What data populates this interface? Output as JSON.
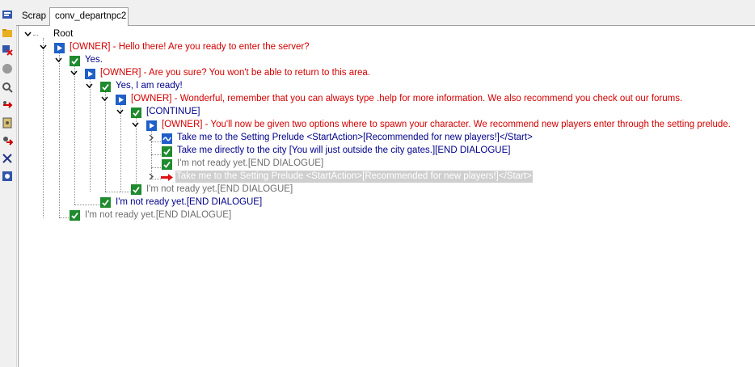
{
  "tabs": [
    {
      "label": "Scrap"
    },
    {
      "label": "conv_departnpc2"
    }
  ],
  "toolbar": {
    "icons": [
      "conversation-icon",
      "folder-icon",
      "delete-icon",
      "disabled-icon",
      "search-icon",
      "move-icon",
      "script-icon",
      "link-icon",
      "cut-icon",
      "settings-icon"
    ]
  },
  "tree": {
    "root": "Root",
    "nodes": [
      {
        "text": "[OWNER] - Hello there! Are you ready to enter the server?",
        "kind": "owner"
      },
      {
        "text": "Yes.",
        "kind": "player"
      },
      {
        "text": "[OWNER] - Are you sure? You won't be able to return to this area.",
        "kind": "owner"
      },
      {
        "text": "Yes, I am ready!",
        "kind": "player"
      },
      {
        "text": "[OWNER] - Wonderful, remember that you can always type .help for more information. We also recommend you check out our forums.",
        "kind": "owner"
      },
      {
        "text": "[CONTINUE]",
        "kind": "player"
      },
      {
        "text": "[OWNER] - You'll now be given two options where to spawn your character. We recommend new players enter through the setting prelude.",
        "kind": "owner"
      },
      {
        "text": "Take me to the Setting Prelude <StartAction>[Recommended for new players!]</Start>",
        "kind": "player-action"
      },
      {
        "text": "Take me directly to the city [You will just outside the city gates.][END DIALOGUE]",
        "kind": "player"
      },
      {
        "text": "I'm not ready yet.[END DIALOGUE]",
        "kind": "player-gray"
      },
      {
        "text": "Take me to the Setting Prelude <StartAction>[Recommended for new players!]</Start>",
        "kind": "link-selected"
      },
      {
        "text": "I'm not ready yet.[END DIALOGUE]",
        "kind": "player-gray"
      },
      {
        "text": "I'm not ready yet.[END DIALOGUE]",
        "kind": "player"
      },
      {
        "text": "I'm not ready yet.[END DIALOGUE]",
        "kind": "player-gray"
      }
    ]
  },
  "colors": {
    "owner_text": "#d40000",
    "player_text": "#00008b",
    "inactive_text": "#6e6e6e",
    "owner_icon": "#1f5fc8",
    "player_icon": "#1f8a2e",
    "link_arrow": "#e01010",
    "selection": "#cfcfcf"
  }
}
